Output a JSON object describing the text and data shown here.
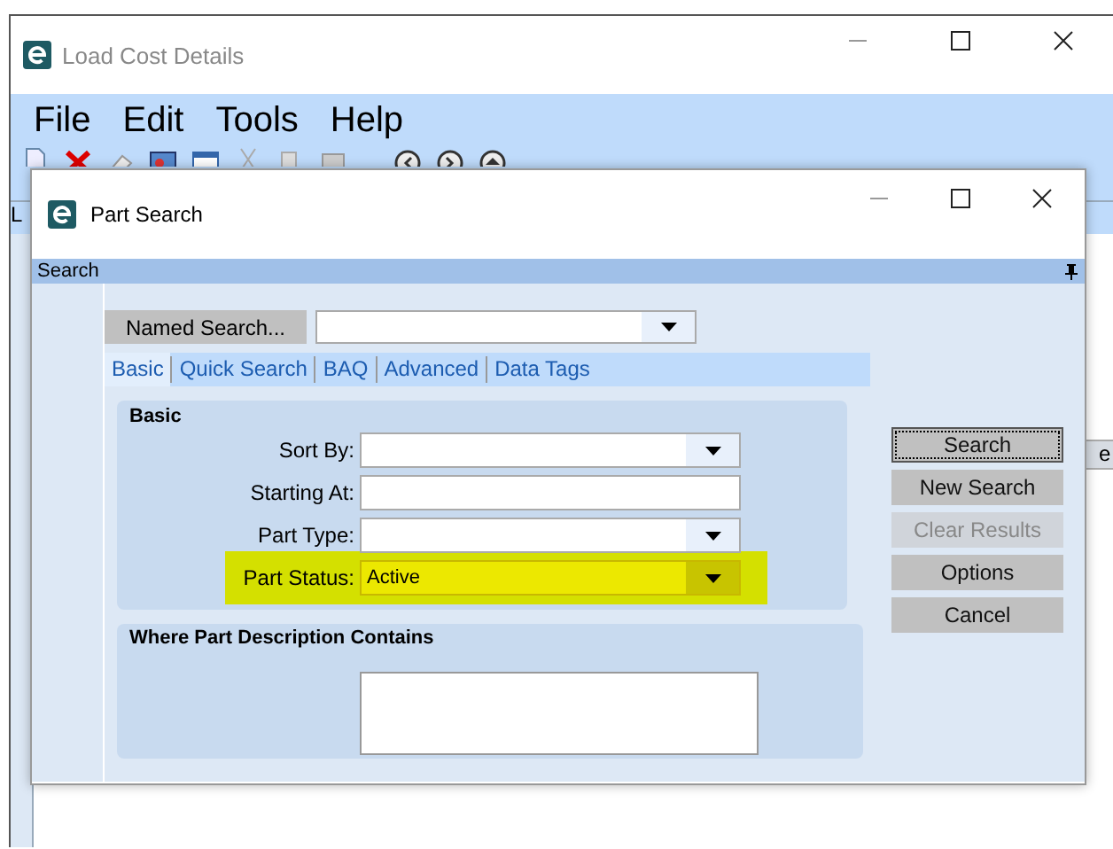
{
  "back_window": {
    "title": "Load Cost  Details",
    "menu": [
      "File",
      "Edit",
      "Tools",
      "Help"
    ],
    "panel_tab": "L",
    "column_header": "e"
  },
  "dialog": {
    "title": "Part Search",
    "header": "Search",
    "named_search_button": "Named Search...",
    "tabs": [
      {
        "label": "Basic",
        "selected": true
      },
      {
        "label": "Quick Search",
        "selected": false
      },
      {
        "label": "BAQ",
        "selected": false
      },
      {
        "label": "Advanced",
        "selected": false
      },
      {
        "label": "Data Tags",
        "selected": false
      }
    ],
    "basic_group": {
      "title": "Basic",
      "fields": [
        {
          "label": "Sort By:",
          "kind": "combo",
          "highlighted": false
        },
        {
          "label": "Starting At:",
          "kind": "text",
          "highlighted": false
        },
        {
          "label": "Part Type:",
          "kind": "combo",
          "highlighted": false
        },
        {
          "label": "Part Status:",
          "kind": "combo",
          "value": "Active",
          "highlighted": true
        }
      ]
    },
    "description_group": {
      "title": "Where Part Description Contains"
    },
    "buttons": [
      {
        "label": "Search",
        "disabled": false,
        "focused": true
      },
      {
        "label": "New Search",
        "disabled": false,
        "focused": false
      },
      {
        "label": "Clear Results",
        "disabled": true,
        "focused": false
      },
      {
        "label": "Options",
        "disabled": false,
        "focused": false
      },
      {
        "label": "Cancel",
        "disabled": false,
        "focused": false
      }
    ]
  }
}
